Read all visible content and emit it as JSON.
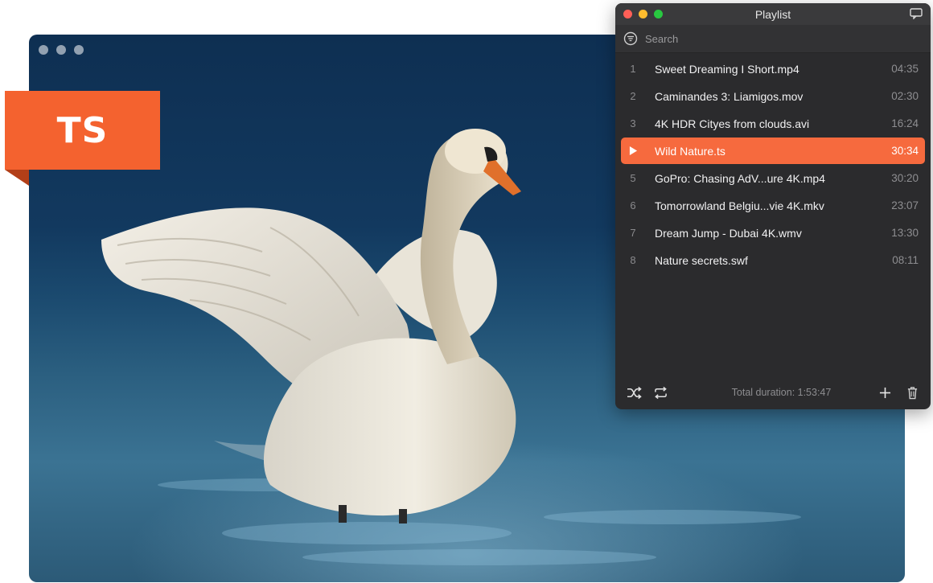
{
  "badge": {
    "format": "TS"
  },
  "player": {
    "window_controls": [
      "close",
      "minimize",
      "maximize"
    ],
    "frame_icon": "swan-on-water-image"
  },
  "playlist": {
    "title": "Playlist",
    "search": {
      "placeholder": "Search",
      "value": ""
    },
    "accent_color": "#f66a3e",
    "items": [
      {
        "index": "1",
        "name": "Sweet Dreaming I Short.mp4",
        "duration": "04:35"
      },
      {
        "index": "2",
        "name": "Caminandes 3: Liamigos.mov",
        "duration": "02:30"
      },
      {
        "index": "3",
        "name": "4K HDR Cityes from clouds.avi",
        "duration": "16:24"
      },
      {
        "index": "4",
        "name": "Wild Nature.ts",
        "duration": "30:34",
        "playing": true
      },
      {
        "index": "5",
        "name": "GoPro: Chasing AdV...ure 4K.mp4",
        "duration": "30:20"
      },
      {
        "index": "6",
        "name": "Tomorrowland Belgiu...vie 4K.mkv",
        "duration": "23:07"
      },
      {
        "index": "7",
        "name": "Dream Jump - Dubai 4K.wmv",
        "duration": "13:30"
      },
      {
        "index": "8",
        "name": "Nature secrets.swf",
        "duration": "08:11"
      }
    ],
    "total_duration": "Total duration: 1:53:47",
    "footer_icons": [
      "shuffle-icon",
      "repeat-icon",
      "add-icon",
      "trash-icon"
    ]
  }
}
